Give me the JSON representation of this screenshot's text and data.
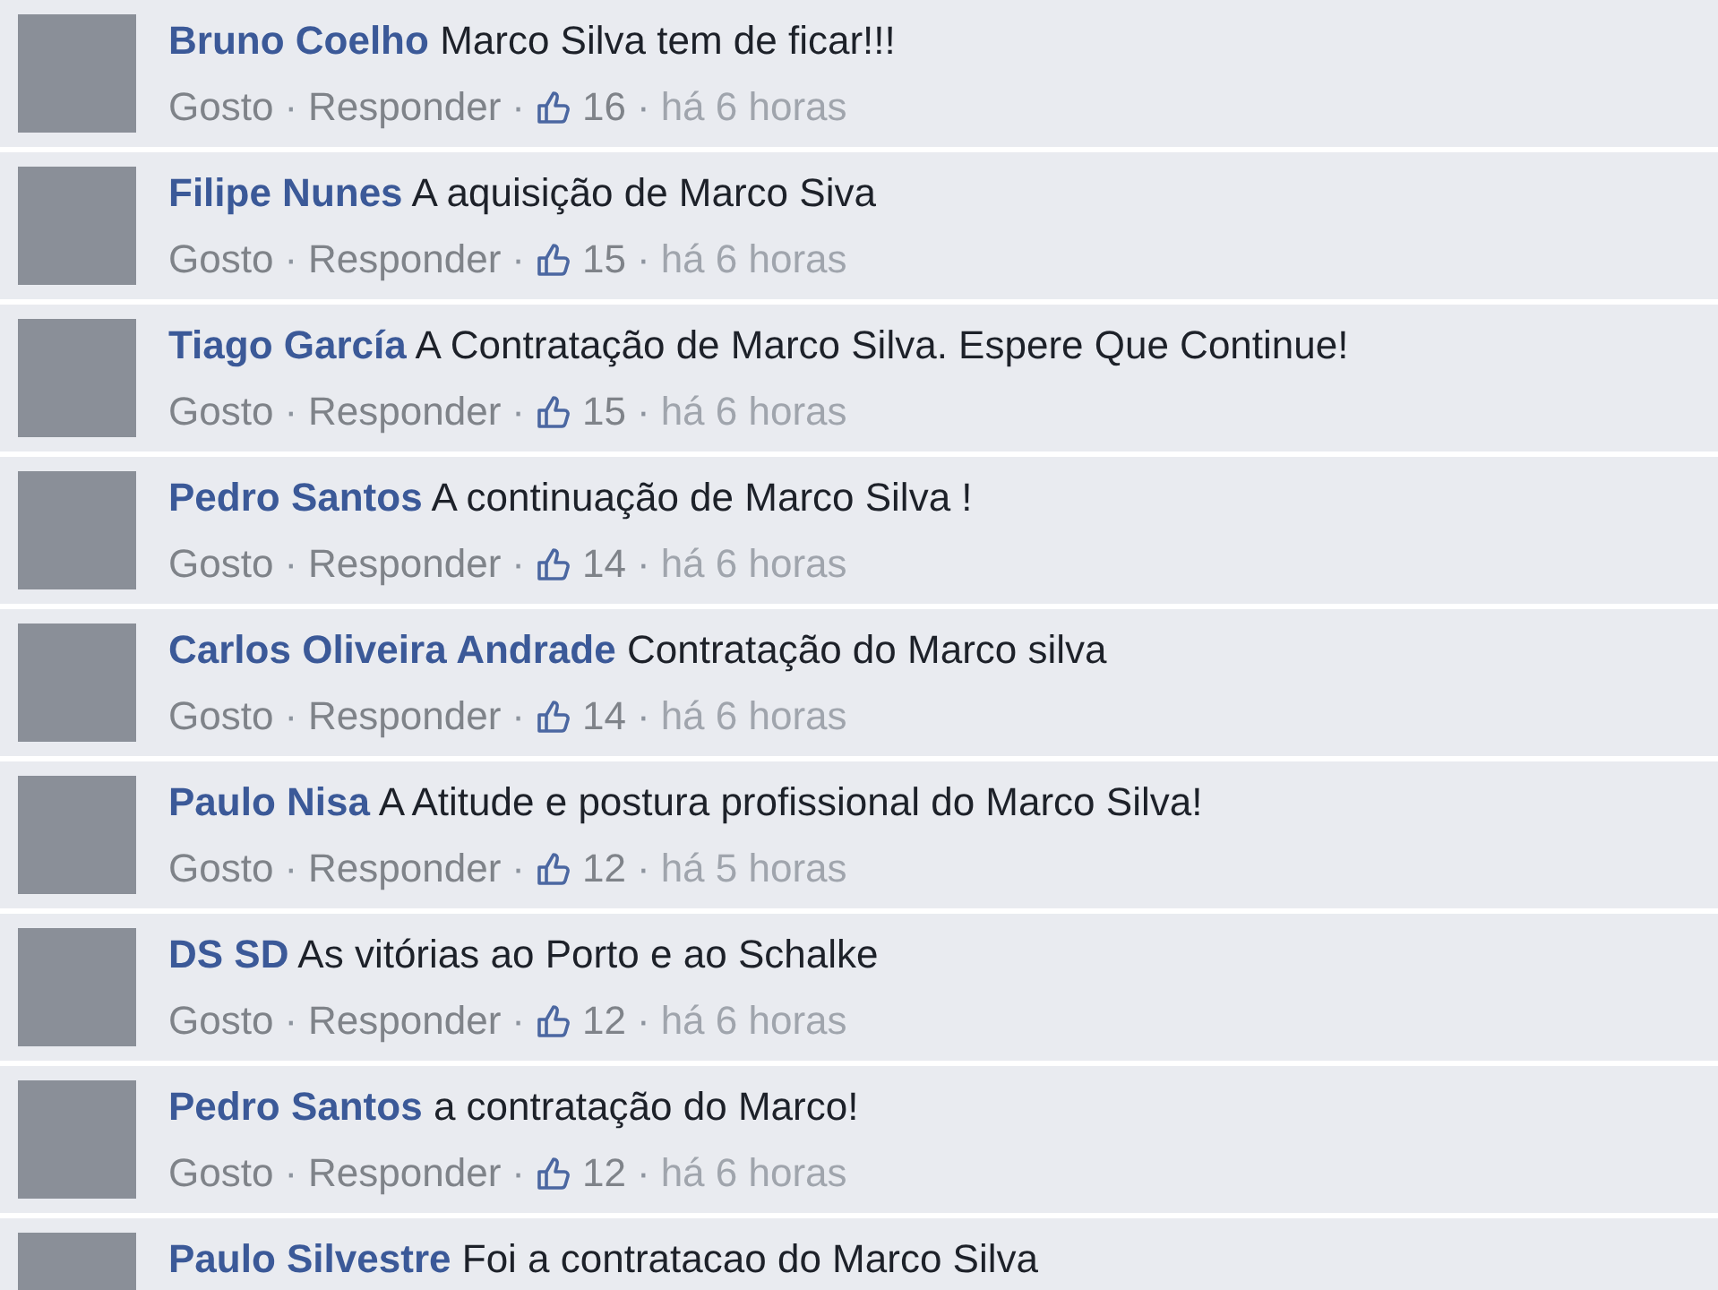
{
  "comments": [
    {
      "author": "Bruno Coelho",
      "text": "Marco Silva tem de ficar!!!",
      "like": "Gosto",
      "reply": "Responder",
      "likes": "16",
      "time": "há 6 horas",
      "separators": [
        "·",
        "·",
        "·"
      ]
    },
    {
      "author": "Filipe Nunes",
      "text": "A aquisição de Marco Siva",
      "like": "Gosto",
      "reply": "Responder",
      "likes": "15",
      "time": "há 6 horas",
      "separators": [
        "·",
        "·",
        "·"
      ]
    },
    {
      "author": "Tiago García",
      "text": "A Contratação de Marco Silva. Espere Que Continue!",
      "like": "Gosto",
      "reply": "Responder",
      "likes": "15",
      "time": "há 6 horas",
      "separators": [
        "·",
        "·",
        "·"
      ]
    },
    {
      "author": "Pedro Santos",
      "text": "A continuação de Marco Silva !",
      "like": "Gosto",
      "reply": "Responder",
      "likes": "14",
      "time": "há 6 horas",
      "separators": [
        "·",
        "·",
        "·"
      ]
    },
    {
      "author": "Carlos Oliveira Andrade",
      "text": "Contratação do Marco silva",
      "like": "Gosto",
      "reply": "Responder",
      "likes": "14",
      "time": "há 6 horas",
      "separators": [
        "·",
        "·",
        "·"
      ]
    },
    {
      "author": "Paulo Nisa",
      "text": "A Atitude e postura profissional do Marco Silva!",
      "like": "Gosto",
      "reply": "Responder",
      "likes": "12",
      "time": "há 5 horas",
      "separators": [
        "·",
        "·",
        "·"
      ]
    },
    {
      "author": "DS SD",
      "text": "As vitórias ao Porto e ao Schalke",
      "like": "Gosto",
      "reply": "Responder",
      "likes": "12",
      "time": "há 6 horas",
      "separators": [
        "·",
        "·",
        "·"
      ]
    },
    {
      "author": "Pedro Santos",
      "text": "a contratação do Marco!",
      "like": "Gosto",
      "reply": "Responder",
      "likes": "12",
      "time": "há 6 horas",
      "separators": [
        "·",
        "·",
        "·"
      ]
    },
    {
      "author": "Paulo Silvestre",
      "text": "Foi a contratacao do Marco Silva"
    }
  ]
}
